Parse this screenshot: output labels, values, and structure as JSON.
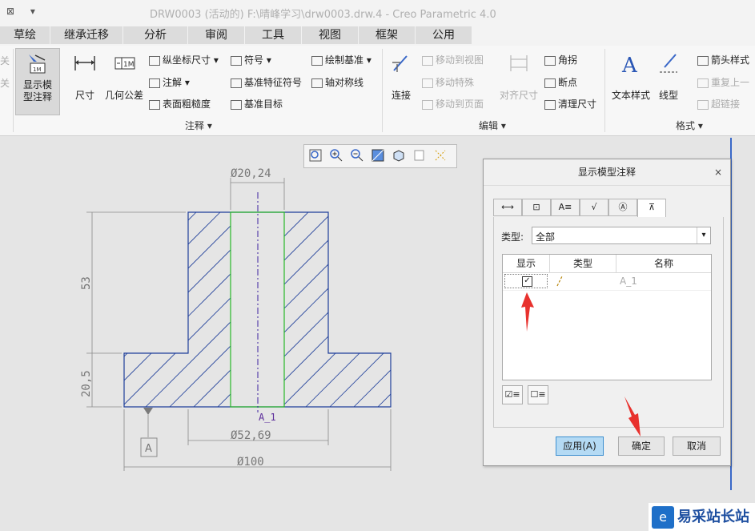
{
  "window": {
    "title": "DRW0003 (活动的) F:\\晴峰学习\\drw0003.drw.4 - Creo Parametric 4.0"
  },
  "tabs": [
    "草绘",
    "继承迁移",
    "分析",
    "审阅",
    "工具",
    "视图",
    "框架",
    "公用"
  ],
  "ribbon": {
    "partial_left": [
      "关",
      "关"
    ],
    "show_model_annotations": "显示模型注释",
    "dimension": "尺寸",
    "geometric_tolerance": "几何公差",
    "ordinate_dimension": "纵坐标尺寸",
    "annotation": "注解",
    "surface_finish": "表面粗糙度",
    "symbol": "符号",
    "datum_feature_symbol": "基准特征符号",
    "datum_target": "基准目标",
    "draw_datum": "绘制基准",
    "axis_symmetry": "轴对称线",
    "connect": "连接",
    "move_to_view": "移动到视图",
    "move_special": "移动特殊",
    "move_to_page": "移动到页面",
    "align_dimension": "对齐尺寸",
    "angle": "角拐",
    "breakpoint": "断点",
    "clean_dimension": "清理尺寸",
    "text_style": "文本样式",
    "line_style": "线型",
    "arrow_style": "箭头样式",
    "repeat": "重复上一",
    "hyperlink": "超链接",
    "group_annotate": "注释",
    "group_edit": "编辑",
    "group_format": "格式"
  },
  "drawing": {
    "dim_top": "Ø20,24",
    "dim_53": "53",
    "dim_20_5": "20,5",
    "dim_mid": "Ø52,69",
    "dim_bottom": "Ø100",
    "datum_label": "A",
    "axis_label": "A_1"
  },
  "dialog": {
    "title": "显示模型注释",
    "close": "×",
    "type_label": "类型:",
    "type_value": "全部",
    "col_show": "显示",
    "col_type": "类型",
    "col_name": "名称",
    "rows": [
      {
        "checked": true,
        "type_icon": "axis",
        "name": "A_1"
      }
    ],
    "apply": "应用(A)",
    "ok": "确定",
    "cancel": "取消"
  },
  "watermark": {
    "text": "易采站长站"
  },
  "colors": {
    "section_outline": "#1f3f9a",
    "hatch": "#1f3f9a",
    "hole_outline": "#28b828",
    "dimension": "#7d7d7d",
    "annotation_arrow": "#e8312d",
    "accent_blue": "#3a68c8"
  }
}
